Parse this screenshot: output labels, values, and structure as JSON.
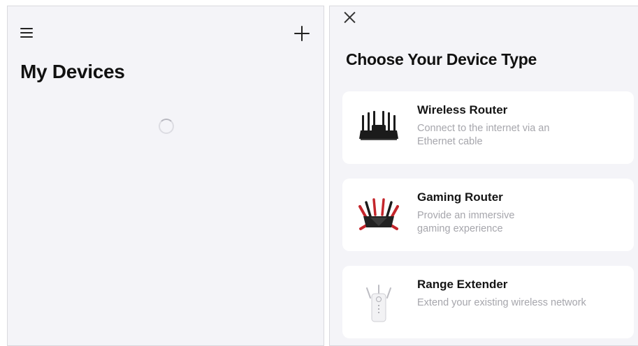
{
  "my_devices": {
    "title": "My Devices",
    "menu_icon": "hamburger-menu-icon",
    "add_icon": "plus-icon",
    "loading_icon": "loading-spinner-icon"
  },
  "device_type_sheet": {
    "close_icon": "close-x-icon",
    "title": "Choose Your Device Type",
    "options": [
      {
        "name": "Wireless Router",
        "description": "Connect to the internet via an\nEthernet cable",
        "icon": "wireless-router-icon"
      },
      {
        "name": "Gaming Router",
        "description": "Provide an immersive\ngaming experience",
        "icon": "gaming-router-icon"
      },
      {
        "name": "Range Extender",
        "description": "Extend your existing wireless network",
        "icon": "range-extender-icon"
      }
    ]
  }
}
